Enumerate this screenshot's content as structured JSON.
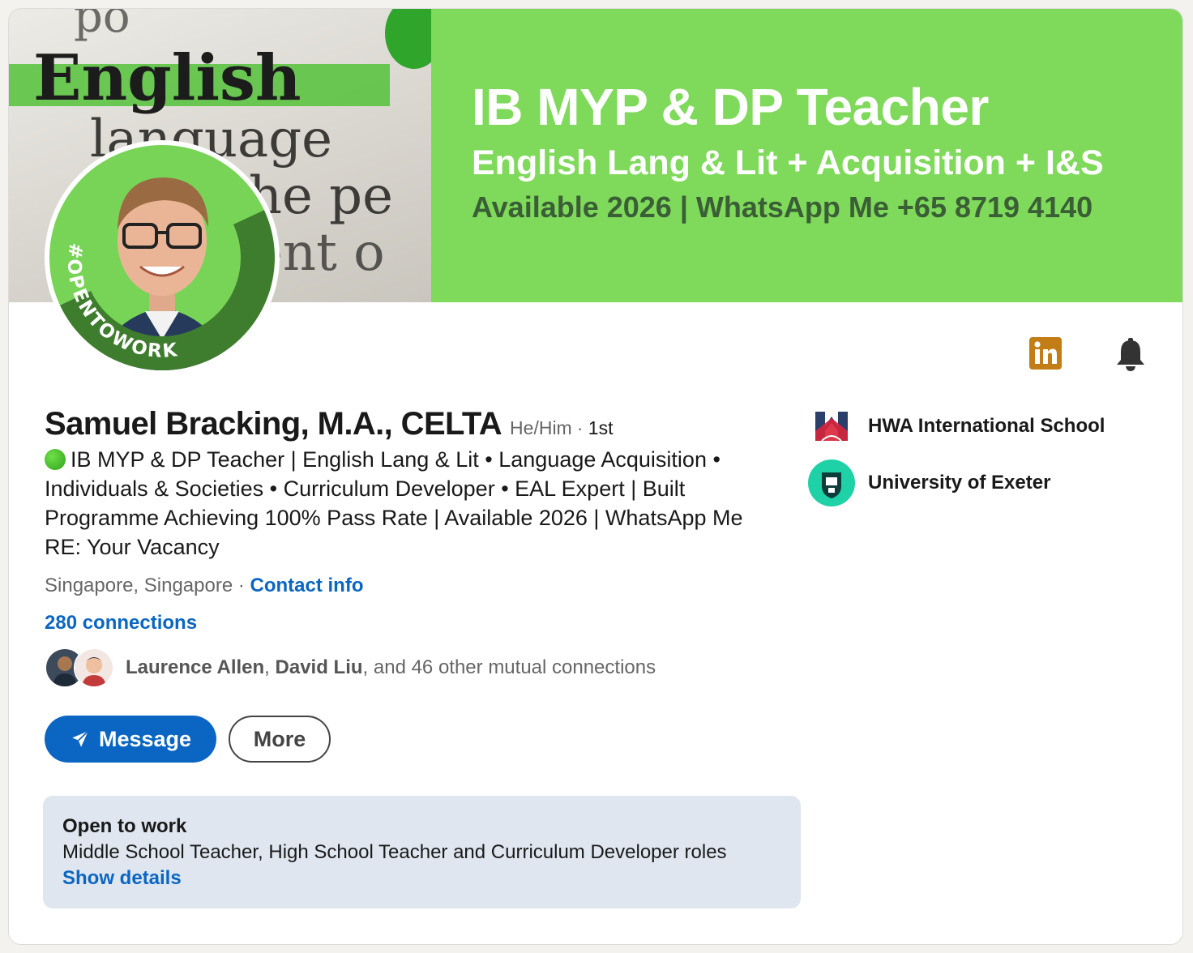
{
  "banner": {
    "bg_color": "#7fd95a",
    "photo_words": [
      "English",
      "language",
      "the pe",
      "ent o"
    ],
    "line1": "IB MYP & DP Teacher",
    "line2": "English Lang & Lit + Acquisition + I&S",
    "line3": "Available 2026 | WhatsApp Me +65 8719 4140"
  },
  "avatar": {
    "frame_text": "#OPENTOWORK",
    "frame_color": "#3f7d2e"
  },
  "actions_icons": {
    "linkedin": "linkedin-icon",
    "bell": "bell-icon",
    "linkedin_color": "#c37d16"
  },
  "profile": {
    "name": "Samuel Bracking, M.A., CELTA",
    "pronouns": "He/Him",
    "degree_sep": "·",
    "degree": "1st",
    "headline": "IB MYP & DP Teacher | English Lang & Lit • Language Acquisition • Individuals & Societies • Curriculum Developer • EAL Expert | Built Programme Achieving 100% Pass Rate | Available 2026 | WhatsApp Me RE: Your Vacancy",
    "location": "Singapore, Singapore",
    "location_sep": "·",
    "contact_info": "Contact info",
    "connections": "280 connections"
  },
  "mutual": {
    "name1": "Laurence Allen",
    "sep": ", ",
    "name2": "David Liu",
    "rest": ", and 46 other mutual connections"
  },
  "buttons": {
    "message": "Message",
    "more": "More"
  },
  "open_to_work": {
    "title": "Open to work",
    "roles": "Middle School Teacher, High School Teacher and Curriculum Developer roles",
    "show_details": "Show details",
    "bg_color": "#dfe6ef"
  },
  "organizations": [
    {
      "name": "HWA International School",
      "logo": "hwa-logo"
    },
    {
      "name": "University of Exeter",
      "logo": "exeter-logo"
    }
  ],
  "colors": {
    "link": "#0a66c2",
    "primary_button": "#0a66c2"
  }
}
